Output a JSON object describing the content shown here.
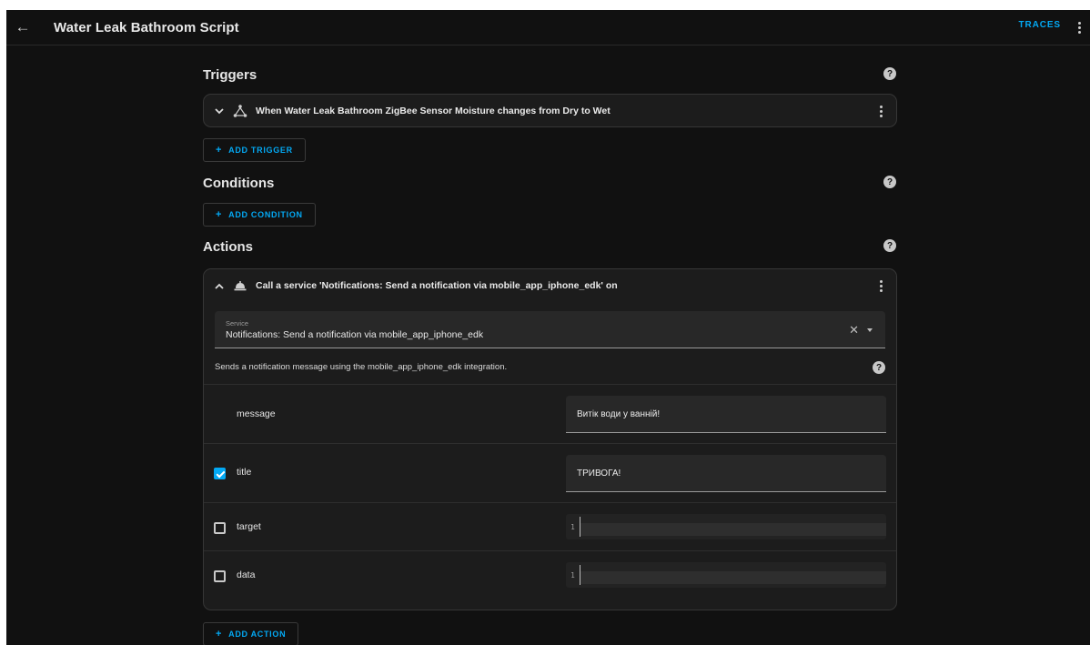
{
  "header": {
    "back_icon": "arrow-left-icon",
    "title": "Water Leak Bathroom Script",
    "traces_label": "TRACES",
    "menu_icon": "dots-vertical-icon"
  },
  "triggers": {
    "title": "Triggers",
    "help_icon": "help-circle-icon",
    "items": [
      {
        "icon": "device-hub-icon",
        "label": "When Water Leak Bathroom ZigBee Sensor Moisture changes from Dry to Wet",
        "expanded": false
      }
    ],
    "add_label": "ADD TRIGGER"
  },
  "conditions": {
    "title": "Conditions",
    "help_icon": "help-circle-icon",
    "add_label": "ADD CONDITION"
  },
  "actions": {
    "title": "Actions",
    "help_icon": "help-circle-icon",
    "items": [
      {
        "icon": "bell-ring-icon",
        "label": "Call a service 'Notifications: Send a notification via mobile_app_iphone_edk' on",
        "expanded": true,
        "service": {
          "label": "Service",
          "value": "Notifications: Send a notification via mobile_app_iphone_edk"
        },
        "description": "Sends a notification message using the mobile_app_iphone_edk integration.",
        "fields": [
          {
            "name": "message",
            "has_checkbox": false,
            "checked": true,
            "kind": "text",
            "value": "Витік води у ванній!"
          },
          {
            "name": "title",
            "has_checkbox": true,
            "checked": true,
            "kind": "text",
            "value": "ТРИВОГА!"
          },
          {
            "name": "target",
            "has_checkbox": true,
            "checked": false,
            "kind": "yaml",
            "line_number": "1"
          },
          {
            "name": "data",
            "has_checkbox": true,
            "checked": false,
            "kind": "yaml",
            "line_number": "1"
          }
        ]
      }
    ],
    "add_label": "ADD ACTION"
  },
  "colors": {
    "accent": "#03a9f4",
    "background": "#111111",
    "card": "#1c1c1c",
    "field": "#282828"
  }
}
